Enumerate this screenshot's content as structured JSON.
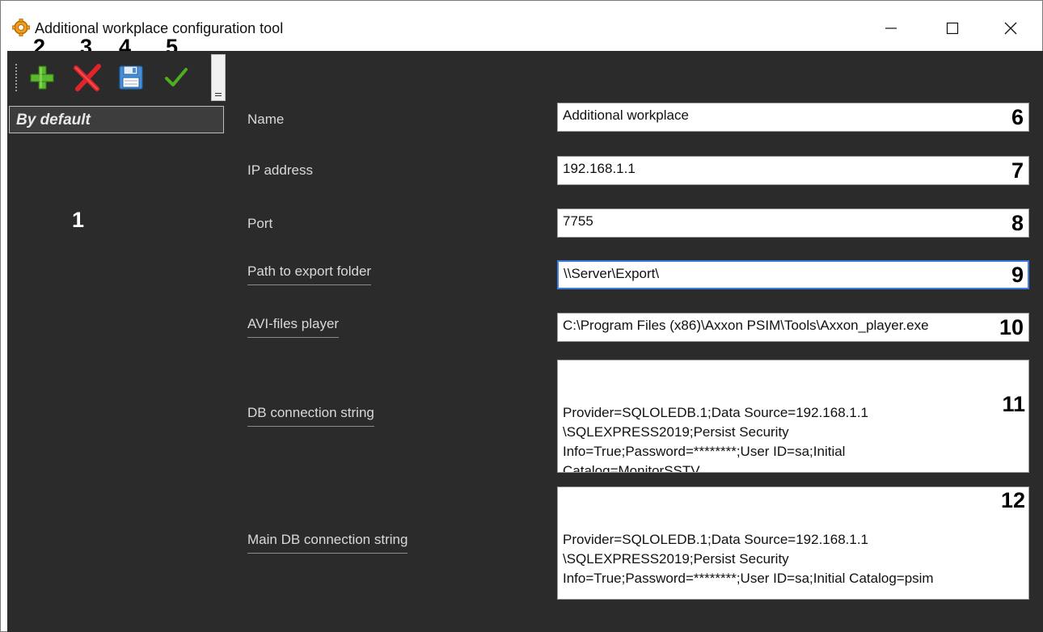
{
  "window": {
    "title": "Additional workplace configuration tool"
  },
  "toolbar": {
    "add_callout": "2",
    "delete_callout": "3",
    "save_callout": "4",
    "apply_callout": "5"
  },
  "sidebar": {
    "items": [
      {
        "label": "By default",
        "selected": true
      }
    ],
    "callout": "1"
  },
  "form": {
    "name": {
      "label": "Name",
      "value": "Additional workplace",
      "callout": "6"
    },
    "ip": {
      "label": "IP address",
      "value": "192.168.1.1",
      "callout": "7"
    },
    "port": {
      "label": "Port",
      "value": "7755",
      "callout": "8"
    },
    "export_path": {
      "label": "Path to export folder",
      "value": "\\\\Server\\Export\\",
      "callout": "9"
    },
    "avi_player": {
      "label": "AVI-files player",
      "value": "C:\\Program Files (x86)\\Axxon PSIM\\Tools\\Axxon_player.exe",
      "callout": "10"
    },
    "db_conn": {
      "label": "DB connection string",
      "value": "Provider=SQLOLEDB.1;Data Source=192.168.1.1\n\\SQLEXPRESS2019;Persist Security\nInfo=True;Password=********;User ID=sa;Initial\nCatalog=MonitorSSTV",
      "callout": "11"
    },
    "main_db_conn": {
      "label": "Main DB connection string",
      "value": "Provider=SQLOLEDB.1;Data Source=192.168.1.1\n\\SQLEXPRESS2019;Persist Security\nInfo=True;Password=********;User ID=sa;Initial Catalog=psim",
      "callout": "12"
    }
  },
  "icons": {
    "app": "gear-icon",
    "add": "plus-icon",
    "delete": "cross-icon",
    "save": "floppy-disk-icon",
    "apply": "checkmark-icon"
  },
  "colors": {
    "panel_bg": "#2b2b2b",
    "focus_border": "#3e7de0",
    "add_green": "#5cb82e",
    "delete_red": "#e0242a",
    "apply_green": "#4caf20"
  }
}
